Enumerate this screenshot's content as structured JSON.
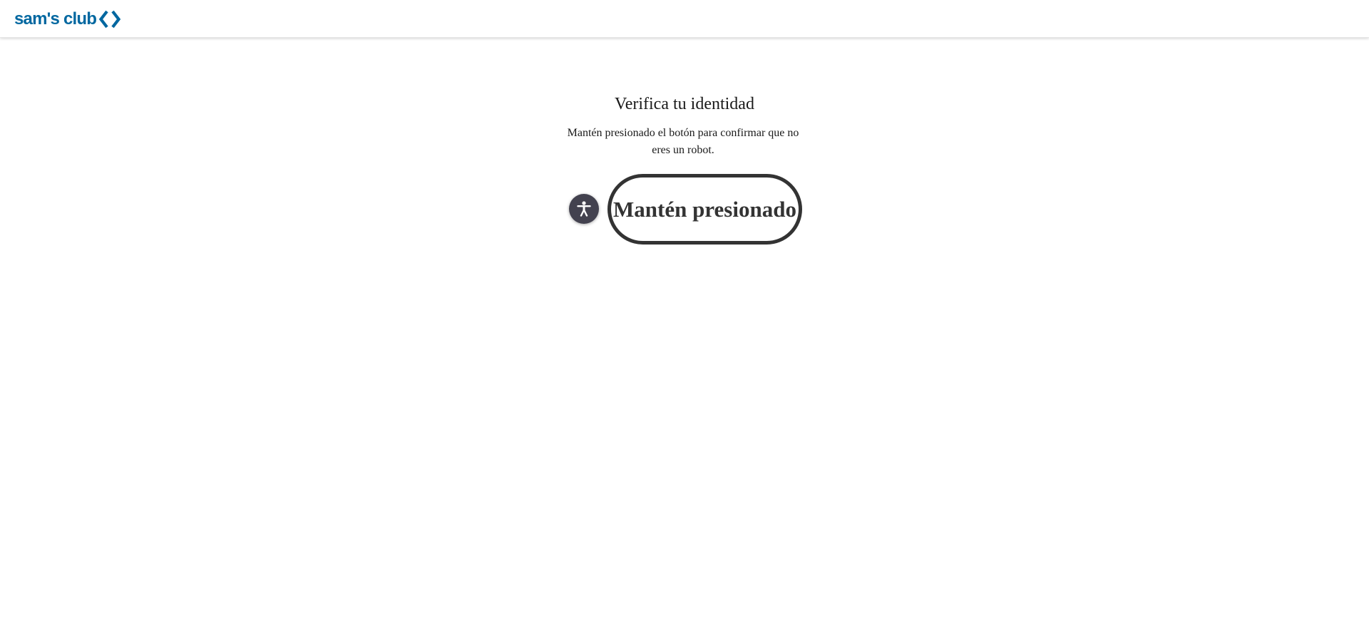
{
  "header": {
    "logo_text": "sam's club",
    "brand_color": "#0067a0"
  },
  "challenge": {
    "title": "Verifica tu identidad",
    "instructions": "Mantén presionado el botón para confirmar que no eres un robot.",
    "hold_button_label": "Mantén presionado",
    "accessibility_icon": "accessibility-icon"
  },
  "colors": {
    "button_border": "#333333",
    "accessibility_bg": "#43424f",
    "text": "#1a1a1a"
  }
}
